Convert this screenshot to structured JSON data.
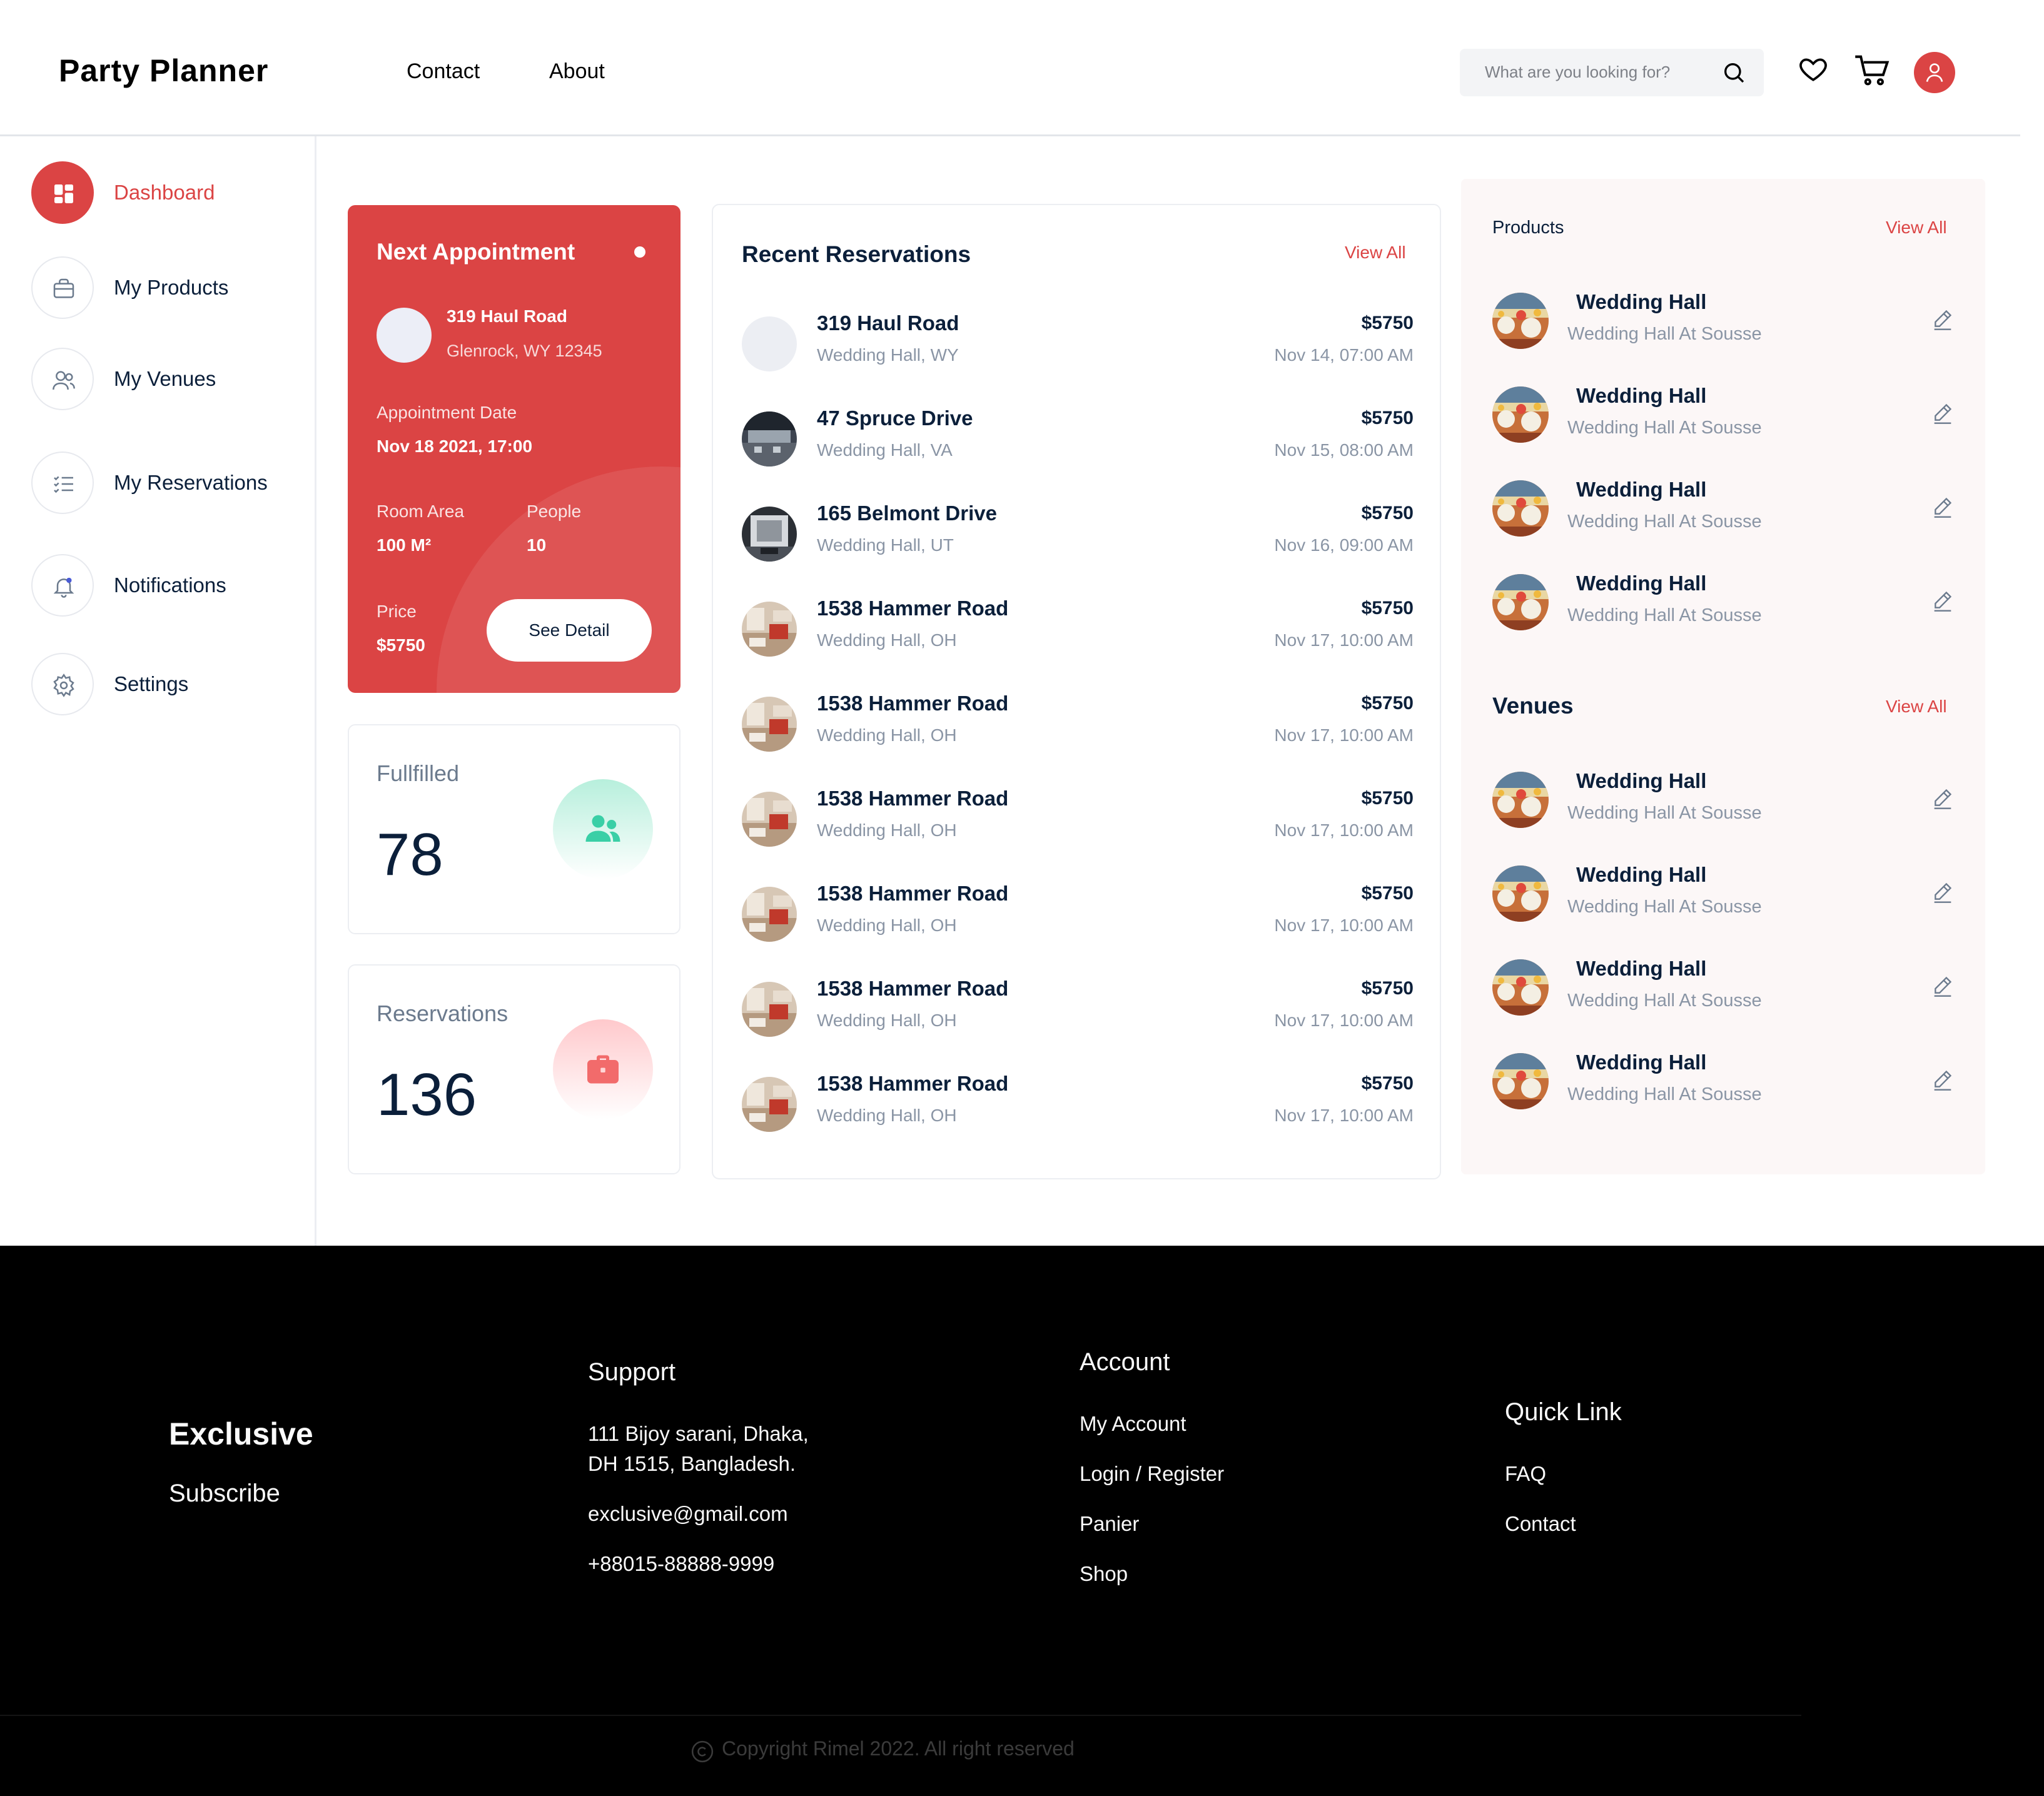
{
  "header": {
    "brand": "Party Planner",
    "nav": [
      "Contact",
      "About"
    ],
    "search_placeholder": "What are you looking for?"
  },
  "sidebar": {
    "items": [
      {
        "label": "Dashboard",
        "icon": "dashboard-icon",
        "active": true
      },
      {
        "label": "My Products",
        "icon": "briefcase-icon"
      },
      {
        "label": "My Venues",
        "icon": "users-icon"
      },
      {
        "label": "My Reservations",
        "icon": "checklist-icon"
      },
      {
        "label": "Notifications",
        "icon": "bell-icon"
      },
      {
        "label": "Settings",
        "icon": "gear-icon"
      }
    ]
  },
  "appointment": {
    "title": "Next Appointment",
    "address": "319 Haul  Road",
    "city": "Glenrock,  WY  12345",
    "date_label": "Appointment Date",
    "date_value": "Nov 18 2021, 17:00",
    "area_label": "Room Area",
    "area_value": "100   M²",
    "people_label": "People",
    "people_value": "10",
    "price_label": "Price",
    "price_value": "$5750",
    "button": "See Detail"
  },
  "stats": {
    "fulfilled": {
      "label": "Fullfilled",
      "value": "78"
    },
    "reservations": {
      "label": "Reservations",
      "value": "136"
    }
  },
  "reservations": {
    "title": "Recent Reservations",
    "view_all": "View All",
    "rows": [
      {
        "name": "319 Haul Road",
        "sub": "Wedding Hall,  WY",
        "price": "$5750",
        "date": "Nov 14, 07:00 AM",
        "thumb": "blank"
      },
      {
        "name": "47 Spruce Drive",
        "sub": "Wedding Hall,  VA",
        "price": "$5750",
        "date": "Nov 15, 08:00 AM",
        "thumb": "hall-dark"
      },
      {
        "name": "165 Belmont Drive",
        "sub": "Wedding Hall,  UT",
        "price": "$5750",
        "date": "Nov 16, 09:00 AM",
        "thumb": "hall-grey"
      },
      {
        "name": "1538 Hammer Road",
        "sub": "Wedding Hall,  OH",
        "price": "$5750",
        "date": "Nov 17, 10:00 AM",
        "thumb": "room"
      },
      {
        "name": "1538 Hammer Road",
        "sub": "Wedding Hall,  OH",
        "price": "$5750",
        "date": "Nov 17, 10:00 AM",
        "thumb": "room"
      },
      {
        "name": "1538 Hammer Road",
        "sub": "Wedding Hall,  OH",
        "price": "$5750",
        "date": "Nov 17, 10:00 AM",
        "thumb": "room"
      },
      {
        "name": "1538 Hammer Road",
        "sub": "Wedding Hall,  OH",
        "price": "$5750",
        "date": "Nov 17, 10:00 AM",
        "thumb": "room"
      },
      {
        "name": "1538 Hammer Road",
        "sub": "Wedding Hall,  OH",
        "price": "$5750",
        "date": "Nov 17, 10:00 AM",
        "thumb": "room"
      },
      {
        "name": "1538 Hammer Road",
        "sub": "Wedding Hall,  OH",
        "price": "$5750",
        "date": "Nov 17, 10:00 AM",
        "thumb": "room"
      }
    ]
  },
  "products": {
    "title": "Products",
    "view_all": "View All",
    "items": [
      {
        "name": "Wedding Hall",
        "sub": "Wedding Hall At Sousse"
      },
      {
        "name": "Wedding Hall",
        "sub": "Wedding Hall At Sousse"
      },
      {
        "name": "Wedding Hall",
        "sub": "Wedding Hall At Sousse"
      },
      {
        "name": "Wedding Hall",
        "sub": "Wedding Hall At Sousse"
      }
    ]
  },
  "venues": {
    "title": "Venues",
    "view_all": "View All",
    "items": [
      {
        "name": "Wedding Hall",
        "sub": "Wedding Hall At Sousse"
      },
      {
        "name": "Wedding Hall",
        "sub": "Wedding Hall At Sousse"
      },
      {
        "name": "Wedding Hall",
        "sub": "Wedding Hall At Sousse"
      },
      {
        "name": "Wedding Hall",
        "sub": "Wedding Hall At Sousse"
      }
    ]
  },
  "footer": {
    "brand": "Exclusive",
    "subscribe": "Subscribe",
    "support_title": "Support",
    "address_line1": "111 Bijoy sarani, Dhaka,",
    "address_line2": "DH 1515, Bangladesh.",
    "email": "exclusive@gmail.com",
    "phone": "+88015-88888-9999",
    "account_title": "Account",
    "account_links": [
      "My Account",
      "Login / Register",
      "Panier",
      "Shop"
    ],
    "quick_title": "Quick Link",
    "quick_links": [
      "FAQ",
      "Contact"
    ],
    "copyright": "Copyright Rimel 2022. All right reserved"
  },
  "colors": {
    "accent": "#DB4444",
    "navy": "#0B1F3A",
    "muted": "#8A95A5",
    "teal": "#3ACFA6",
    "panel_bg": "#FCF7F7"
  }
}
